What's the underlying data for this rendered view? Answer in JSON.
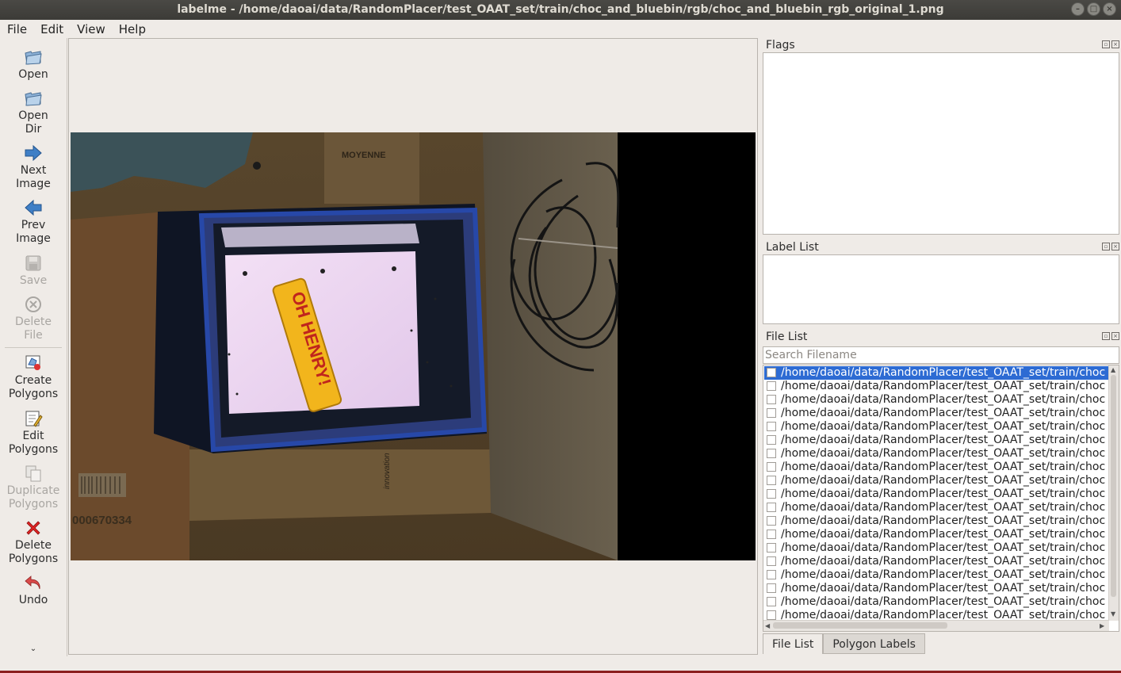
{
  "window": {
    "title": "labelme - /home/daoai/data/RandomPlacer/test_OAAT_set/train/choc_and_bluebin/rgb/choc_and_bluebin_rgb_original_1.png"
  },
  "menu": [
    "File",
    "Edit",
    "View",
    "Help"
  ],
  "tools": {
    "open": "Open",
    "open_dir": "Open Dir",
    "next_image": "Next Image",
    "prev_image": "Prev Image",
    "save": "Save",
    "delete_file": "Delete File",
    "create_polygons": "Create Polygons",
    "edit_polygons": "Edit Polygons",
    "duplicate_polygons": "Duplicate Polygons",
    "delete_polygons": "Delete Polygons",
    "undo": "Undo"
  },
  "docks": {
    "flags_title": "Flags",
    "label_list_title": "Label List",
    "file_list_title": "File List"
  },
  "search": {
    "placeholder": "Search Filename"
  },
  "files": [
    "/home/daoai/data/RandomPlacer/test_OAAT_set/train/choc",
    "/home/daoai/data/RandomPlacer/test_OAAT_set/train/choc",
    "/home/daoai/data/RandomPlacer/test_OAAT_set/train/choc",
    "/home/daoai/data/RandomPlacer/test_OAAT_set/train/choc",
    "/home/daoai/data/RandomPlacer/test_OAAT_set/train/choc",
    "/home/daoai/data/RandomPlacer/test_OAAT_set/train/choc",
    "/home/daoai/data/RandomPlacer/test_OAAT_set/train/choc",
    "/home/daoai/data/RandomPlacer/test_OAAT_set/train/choc",
    "/home/daoai/data/RandomPlacer/test_OAAT_set/train/choc",
    "/home/daoai/data/RandomPlacer/test_OAAT_set/train/choc",
    "/home/daoai/data/RandomPlacer/test_OAAT_set/train/choc",
    "/home/daoai/data/RandomPlacer/test_OAAT_set/train/choc",
    "/home/daoai/data/RandomPlacer/test_OAAT_set/train/choc",
    "/home/daoai/data/RandomPlacer/test_OAAT_set/train/choc",
    "/home/daoai/data/RandomPlacer/test_OAAT_set/train/choc",
    "/home/daoai/data/RandomPlacer/test_OAAT_set/train/choc",
    "/home/daoai/data/RandomPlacer/test_OAAT_set/train/choc",
    "/home/daoai/data/RandomPlacer/test_OAAT_set/train/choc",
    "/home/daoai/data/RandomPlacer/test_OAAT_set/train/choc"
  ],
  "tabs": [
    "File List",
    "Polygon Labels"
  ],
  "image_text": {
    "box_label": "MOYENNE",
    "bar_brand": "OH HENRY!",
    "barcode_number": "000670334",
    "box_brand": "innovation"
  }
}
